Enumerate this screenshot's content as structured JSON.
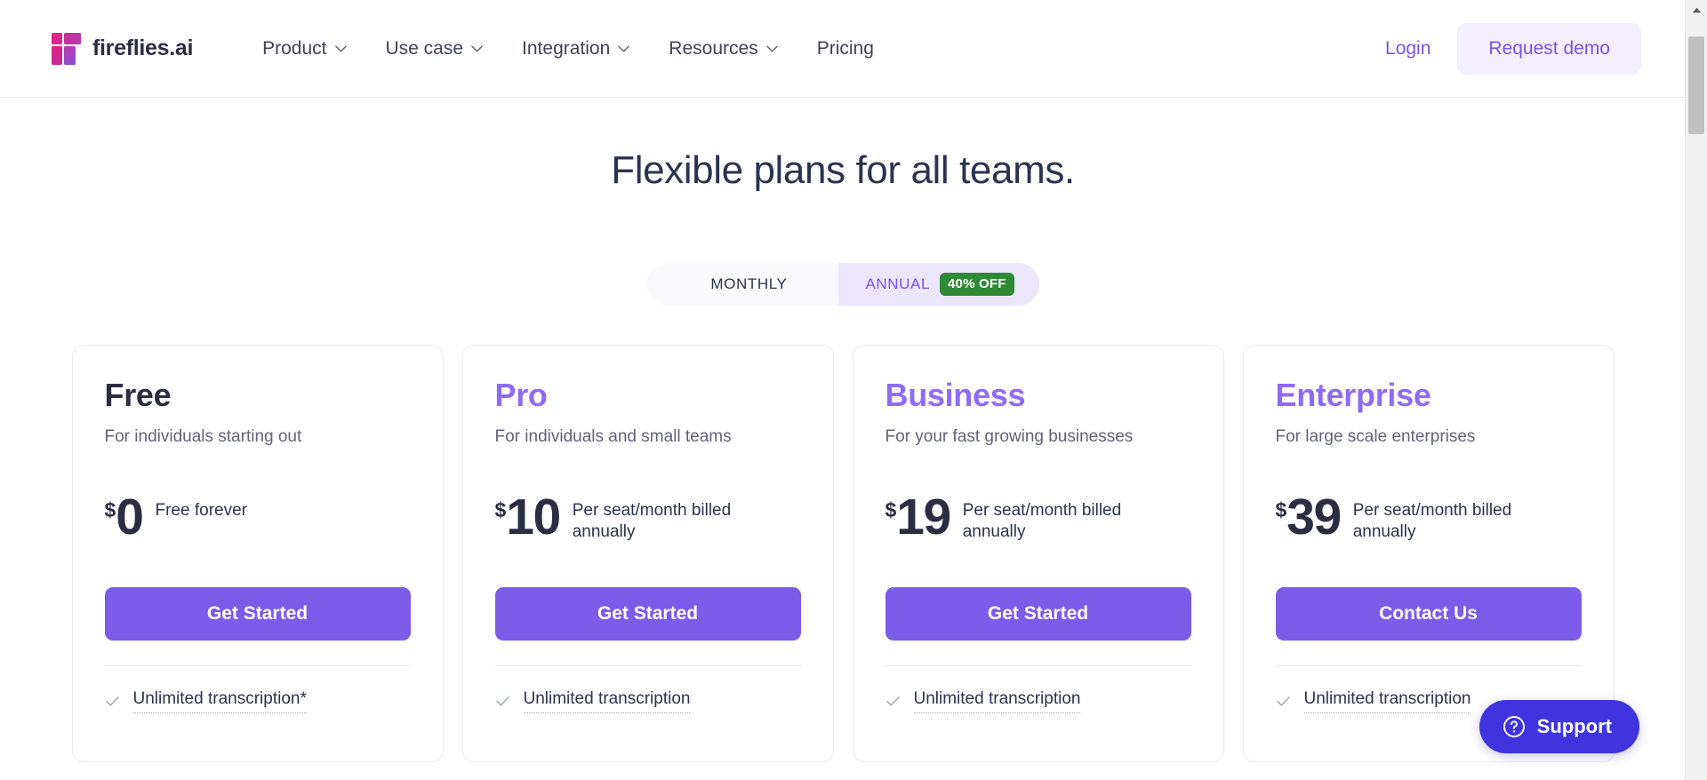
{
  "header": {
    "brand": {
      "name": "fireflies.ai",
      "logo_icon": "fireflies-logo-icon"
    },
    "nav": [
      {
        "label": "Product",
        "has_chevron": true
      },
      {
        "label": "Use case",
        "has_chevron": true
      },
      {
        "label": "Integration",
        "has_chevron": true
      },
      {
        "label": "Resources",
        "has_chevron": true
      },
      {
        "label": "Pricing",
        "has_chevron": false
      }
    ],
    "login_label": "Login",
    "demo_label": "Request demo",
    "accent_purple": "#7b52e8",
    "demo_bg": "#f3efff"
  },
  "hero": {
    "title": "Flexible plans for all teams."
  },
  "billing_toggle": {
    "monthly_label": "MONTHLY",
    "annual_label": "ANNUAL",
    "discount_badge": "40% OFF",
    "selected": "ANNUAL",
    "badge_color": "#2f8a36",
    "active_bg": "#ece6fd"
  },
  "plans": [
    {
      "name": "Free",
      "name_color": "#2b2d42",
      "description": "For individuals starting out",
      "currency": "$",
      "amount": "0",
      "price_note": "Free forever",
      "cta_label": "Get Started",
      "features": [
        {
          "label": "Unlimited transcription*",
          "check_icon": "check-icon"
        }
      ]
    },
    {
      "name": "Pro",
      "name_color": "#8f6bf5",
      "description": "For individuals and small teams",
      "currency": "$",
      "amount": "10",
      "price_note": "Per seat/month billed annually",
      "cta_label": "Get Started",
      "features": [
        {
          "label": "Unlimited transcription",
          "check_icon": "check-icon"
        }
      ]
    },
    {
      "name": "Business",
      "name_color": "#8f6bf5",
      "description": "For your fast growing businesses",
      "currency": "$",
      "amount": "19",
      "price_note": "Per seat/month billed annually",
      "cta_label": "Get Started",
      "features": [
        {
          "label": "Unlimited transcription",
          "check_icon": "check-icon"
        }
      ]
    },
    {
      "name": "Enterprise",
      "name_color": "#8f6bf5",
      "description": "For large scale enterprises",
      "currency": "$",
      "amount": "39",
      "price_note": "Per seat/month billed annually",
      "cta_label": "Contact Us",
      "features": [
        {
          "label": "Unlimited transcription",
          "check_icon": "check-icon"
        }
      ]
    }
  ],
  "support_widget": {
    "label": "Support",
    "icon": "question-circle-icon",
    "color": "#3f34e0"
  },
  "scrollbar": {
    "up_arrow_icon": "scroll-up-arrow-icon",
    "thumb_color": "#c1c1c1"
  }
}
